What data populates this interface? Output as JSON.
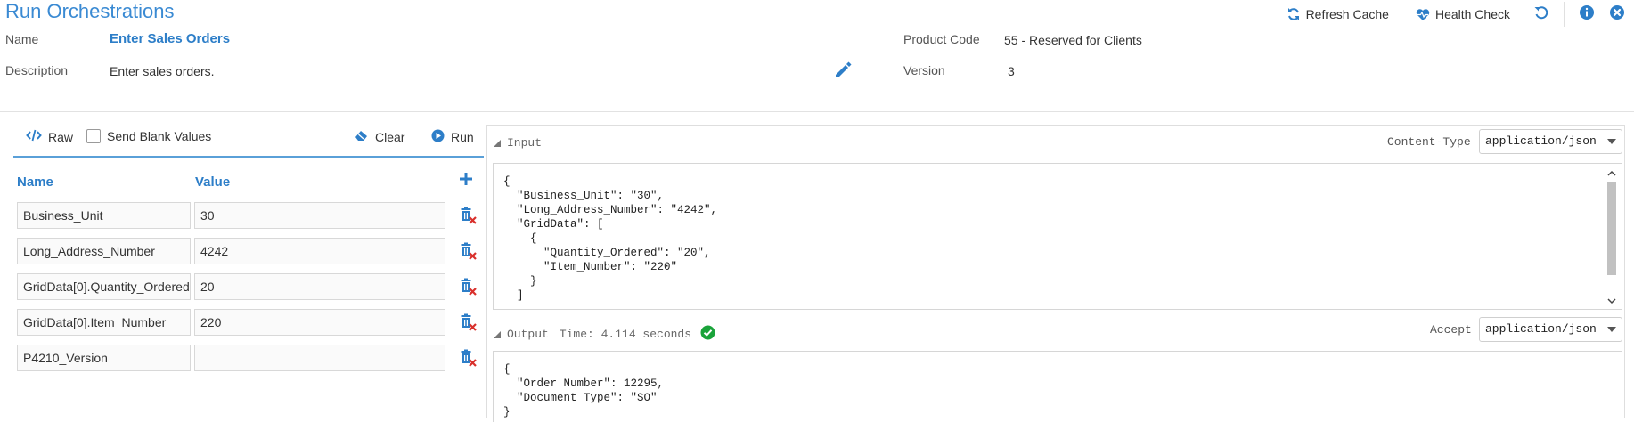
{
  "header": {
    "title": "Run Orchestrations",
    "name_label": "Name",
    "name_value": "Enter Sales Orders",
    "description_label": "Description",
    "description_value": "Enter sales orders.",
    "product_code_label": "Product Code",
    "product_code_value": "55 - Reserved for Clients",
    "version_label": "Version",
    "version_value": "3",
    "edit_icon": "pencil-icon",
    "actions": {
      "refresh_cache": "Refresh Cache",
      "health_check": "Health Check",
      "refresh_icon": "undo-refresh-icon",
      "info_icon": "info-icon",
      "close_icon": "close-icon"
    }
  },
  "left_panel": {
    "raw_label": "Raw",
    "send_blank_label": "Send Blank Values",
    "send_blank_checked": false,
    "clear_label": "Clear",
    "run_label": "Run",
    "name_header": "Name",
    "value_header": "Value",
    "add_icon": "plus-icon",
    "rows": [
      {
        "name": "Business_Unit",
        "value": "30"
      },
      {
        "name": "Long_Address_Number",
        "value": "4242"
      },
      {
        "name": "GridData[0].Quantity_Ordered",
        "value": "20"
      },
      {
        "name": "GridData[0].Item_Number",
        "value": "220"
      },
      {
        "name": "P4210_Version",
        "value": ""
      }
    ]
  },
  "input_section": {
    "label": "Input",
    "content_type_label": "Content-Type",
    "content_type_value": "application/json",
    "body": "{\n  \"Business_Unit\": \"30\",\n  \"Long_Address_Number\": \"4242\",\n  \"GridData\": [\n    {\n      \"Quantity_Ordered\": \"20\",\n      \"Item_Number\": \"220\"\n    }\n  ]"
  },
  "output_section": {
    "label": "Output",
    "time_text": "Time: 4.114 seconds",
    "status": "success",
    "accept_label": "Accept",
    "accept_value": "application/json",
    "body": "{\n  \"Order Number\": 12295,\n  \"Document Type\": \"SO\"\n}"
  },
  "colors": {
    "accent": "#2d7ec8",
    "title": "#3a8ad3",
    "success": "#1aa33a",
    "delete_red": "#d9302c"
  }
}
